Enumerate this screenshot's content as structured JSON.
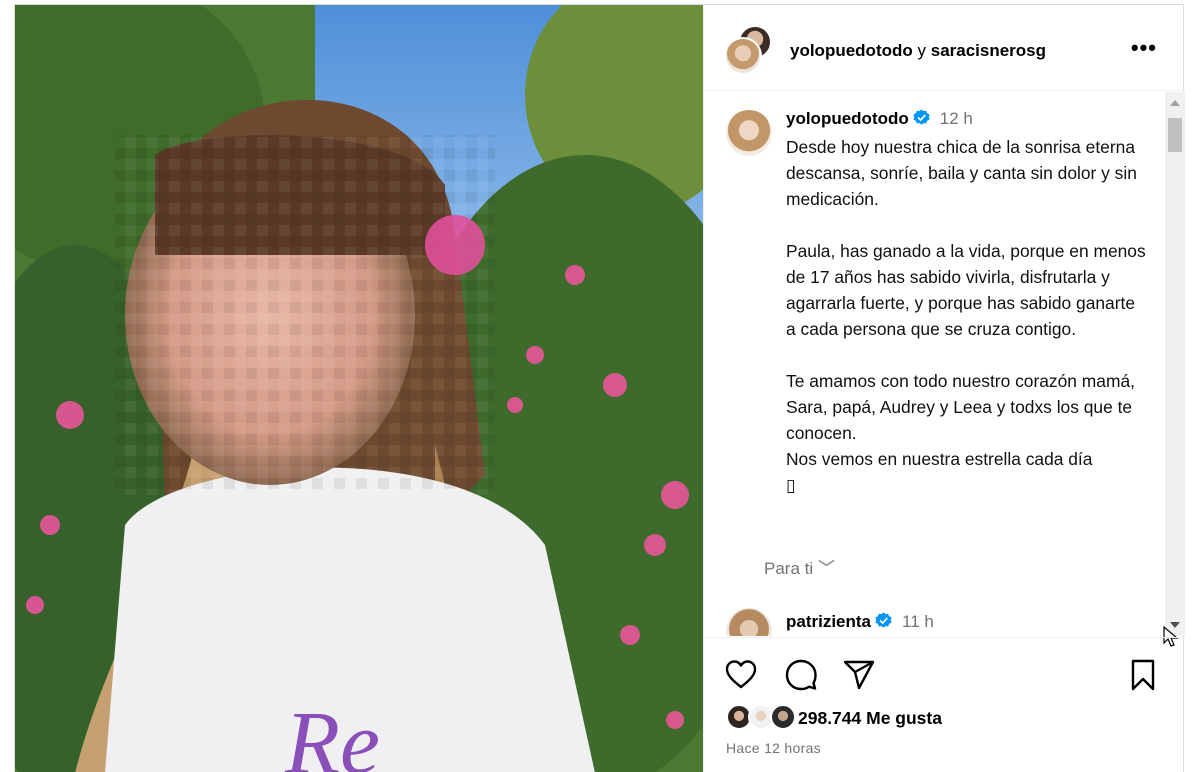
{
  "header": {
    "user1": "yolopuedotodo",
    "connector": "y",
    "user2": "saracisnerosg",
    "more_label": "•••"
  },
  "post": {
    "username": "yolopuedotodo",
    "verified": true,
    "time": "12 h",
    "caption": "Desde hoy nuestra chica de la sonrisa eterna descansa, sonríe, baila y canta sin dolor y sin medicación.\n\nPaula, has ganado a la vida, porque en menos de 17 años has sabido vivirla, disfrutarla y agarrarla fuerte, y porque has sabido ganarte a cada persona que se cruza contigo.\n\nTe amamos con todo nuestro corazón mamá, Sara, papá, Audrey y Leea y todxs los que te conocen.\nNos vemos en nuestra estrella cada día\n▯",
    "translate_label": "Para ti ﹀"
  },
  "comment": {
    "username": "patrizienta",
    "verified": true,
    "time": "11 h"
  },
  "actions": {
    "likes": "298.744 Me gusta",
    "ago": "Hace 12 horas"
  },
  "icons": [
    "heart-icon",
    "comment-icon",
    "share-icon",
    "bookmark-icon",
    "verified-badge-icon",
    "more-options-icon"
  ],
  "colors": {
    "verified": "#0095f6",
    "muted": "#737373",
    "border": "#dbdbdb"
  }
}
